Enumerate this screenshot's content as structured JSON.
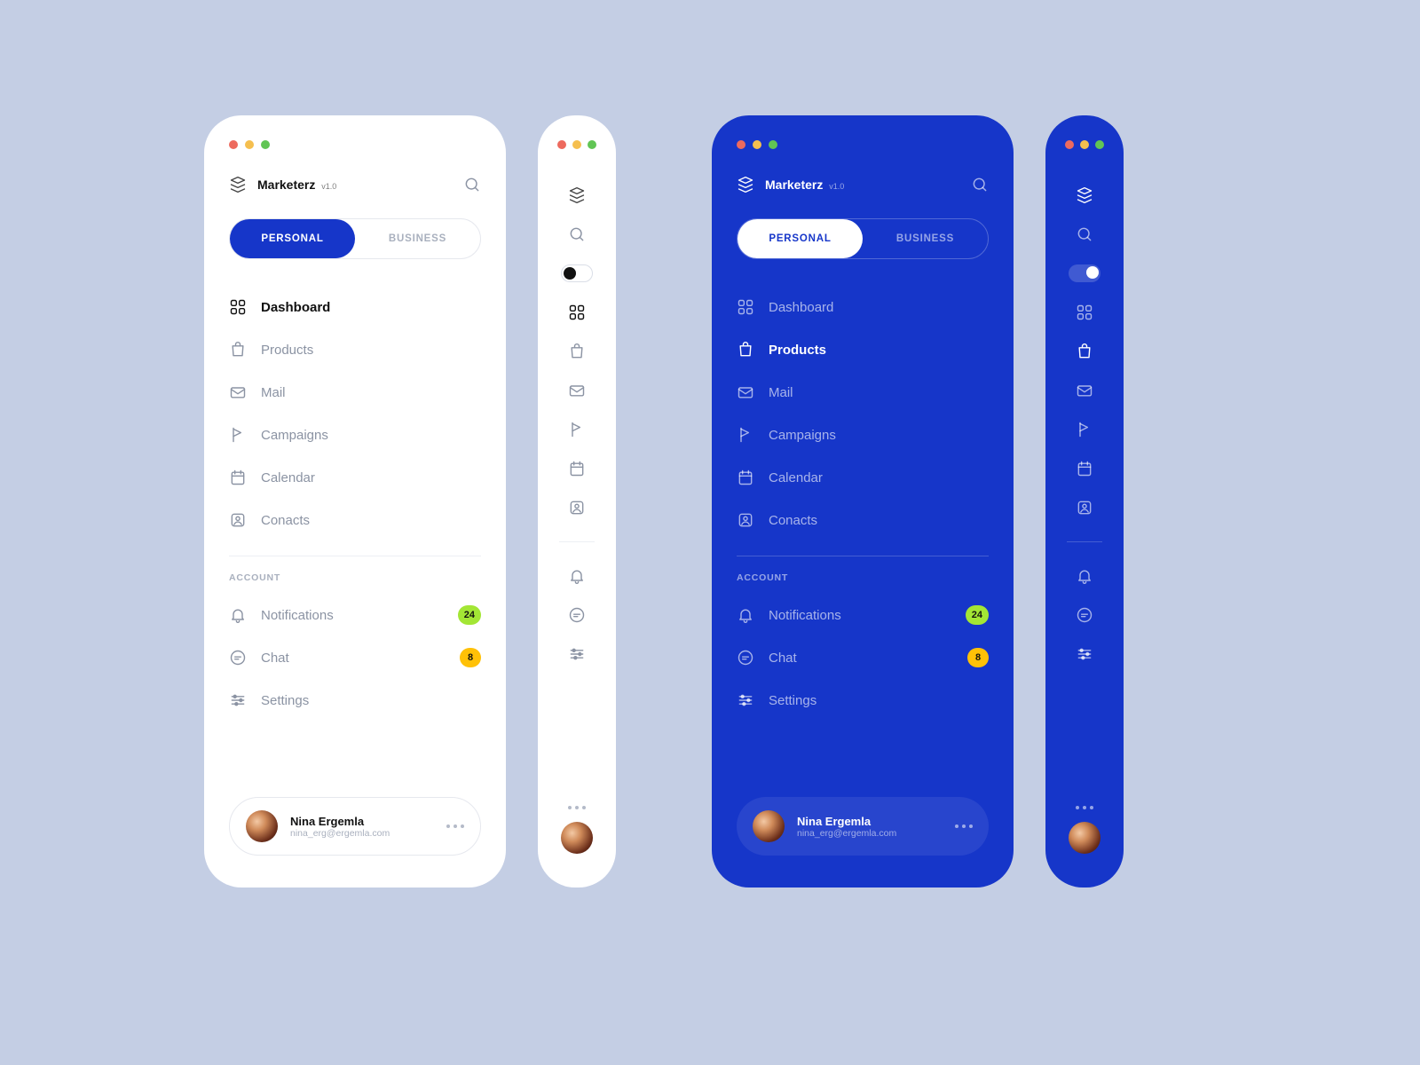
{
  "brand": {
    "name": "Marketerz",
    "version": "v1.0"
  },
  "tabs": {
    "personal": "PERSONAL",
    "business": "BUSINESS"
  },
  "nav": {
    "dashboard": "Dashboard",
    "products": "Products",
    "mail": "Mail",
    "campaigns": "Campaigns",
    "calendar": "Calendar",
    "contacts": "Conacts"
  },
  "section": {
    "account": "ACCOUNT"
  },
  "account": {
    "notifications": {
      "label": "Notifications",
      "count": "24"
    },
    "chat": {
      "label": "Chat",
      "count": "8"
    },
    "settings": {
      "label": "Settings"
    }
  },
  "user": {
    "name": "Nina Ergemla",
    "email": "nina_erg@ergemla.com"
  },
  "colors": {
    "accent_blue": "#1636C9",
    "badge_green": "#A3E635",
    "badge_yellow": "#FFC107"
  }
}
